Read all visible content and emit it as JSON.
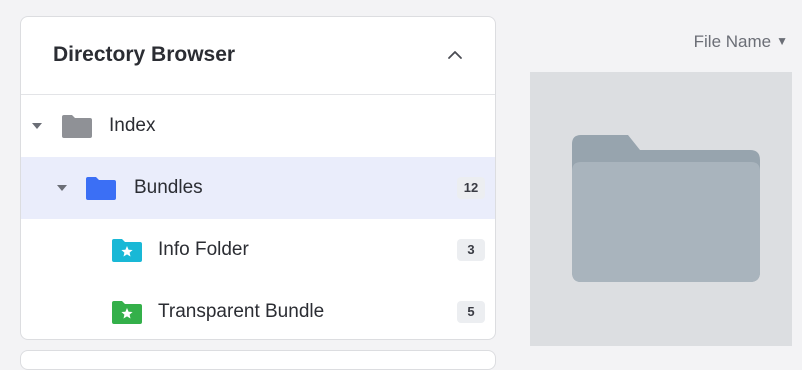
{
  "sidebar": {
    "title": "Directory Browser",
    "items": [
      {
        "label": "Index",
        "expanded": true,
        "icon": "folder-icon",
        "color": "#8f9196"
      },
      {
        "label": "Bundles",
        "count": "12",
        "expanded": true,
        "selected": true,
        "icon": "folder-icon",
        "color": "#3b6ff5"
      },
      {
        "label": "Info Folder",
        "count": "3",
        "icon": "star-folder-icon",
        "color": "#19b8d6"
      },
      {
        "label": "Transparent Bundle",
        "count": "5",
        "icon": "star-folder-icon",
        "color": "#34b04a"
      }
    ]
  },
  "content": {
    "sort_label": "File Name",
    "preview_icon": "folder-icon",
    "preview_color": "#a9b4bd"
  }
}
